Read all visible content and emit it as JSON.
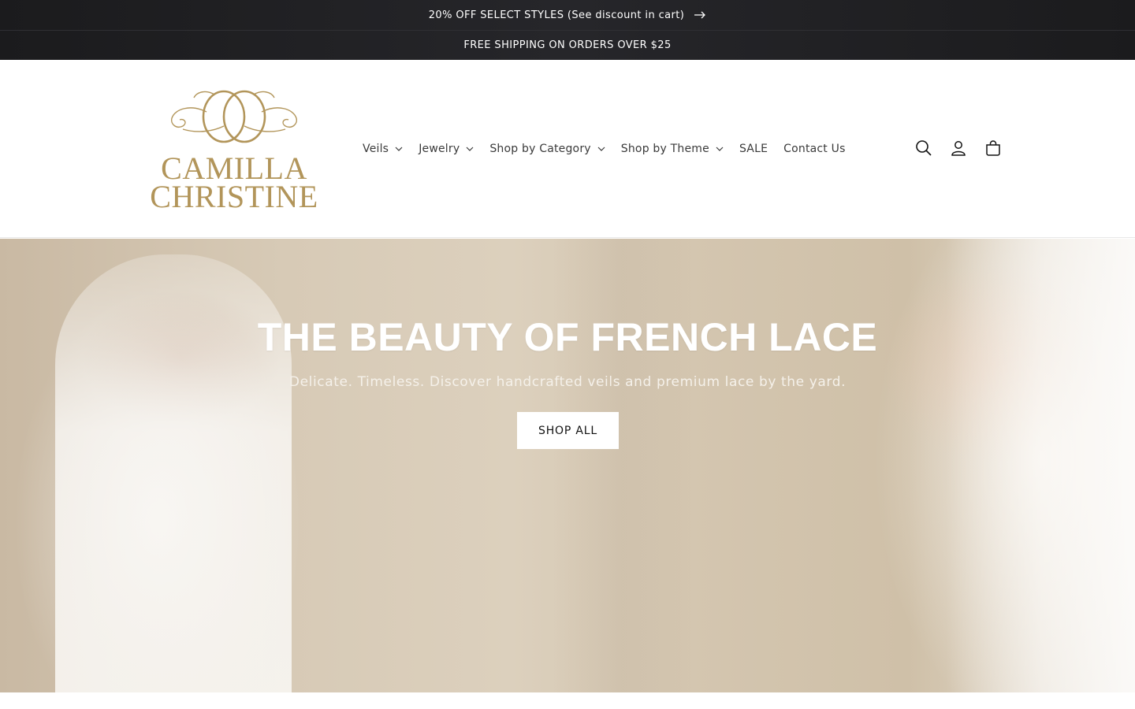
{
  "announcements": {
    "primary": "20% OFF SELECT STYLES (See discount in cart)",
    "primary_icon": "arrow-right-icon",
    "secondary": "FREE SHIPPING ON ORDERS OVER $25"
  },
  "brand": {
    "line1": "CAMILLA",
    "line2": "CHRISTINE",
    "color": "#b2955a"
  },
  "nav": {
    "items": [
      {
        "label": "Veils",
        "has_dropdown": true
      },
      {
        "label": "Jewelry",
        "has_dropdown": true
      },
      {
        "label": "Shop by Category",
        "has_dropdown": true
      },
      {
        "label": "Shop by Theme",
        "has_dropdown": true
      },
      {
        "label": "SALE",
        "has_dropdown": false
      },
      {
        "label": "Contact Us",
        "has_dropdown": false
      }
    ]
  },
  "header_icons": [
    "search-icon",
    "account-icon",
    "cart-icon"
  ],
  "hero": {
    "title": "THE BEAUTY OF FRENCH LACE",
    "subtitle": "Delicate. Timeless. Discover handcrafted veils and premium lace by the yard.",
    "button_label": "SHOP ALL"
  },
  "colors": {
    "announcement_bg": "#1b1b1d",
    "text": "#121212",
    "accent_gold": "#b2955a"
  }
}
